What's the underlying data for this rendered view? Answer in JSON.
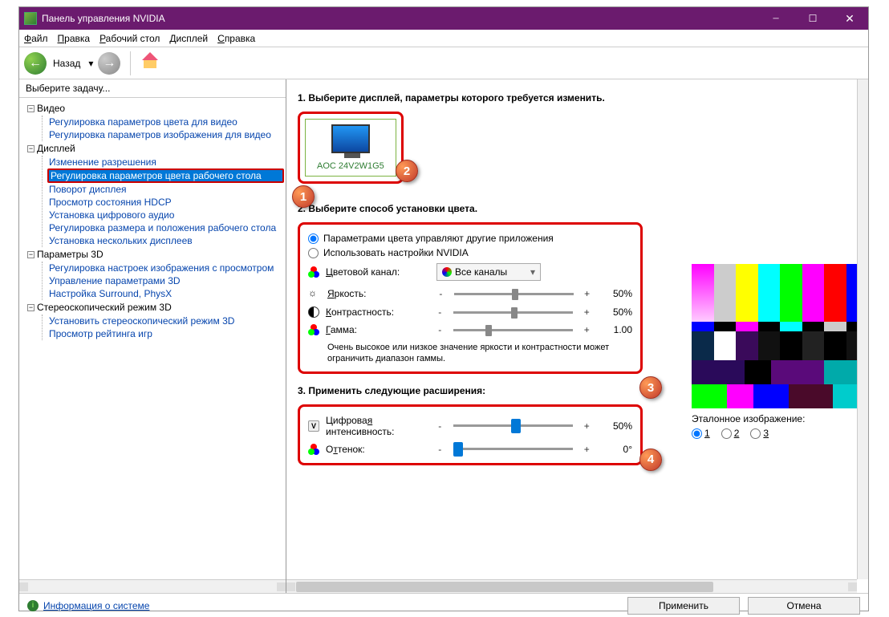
{
  "window": {
    "title": "Панель управления NVIDIA"
  },
  "menu": {
    "file": "Файл",
    "edit": "Правка",
    "desktop": "Рабочий стол",
    "display": "Дисплей",
    "help": "Справка"
  },
  "toolbar": {
    "back": "Назад"
  },
  "sidebar": {
    "header": "Выберите задачу...",
    "groups": [
      {
        "label": "Видео",
        "items": [
          "Регулировка параметров цвета для видео",
          "Регулировка параметров изображения для видео"
        ]
      },
      {
        "label": "Дисплей",
        "items": [
          "Изменение разрешения",
          "Регулировка параметров цвета рабочего стола",
          "Поворот дисплея",
          "Просмотр состояния HDCP",
          "Установка цифрового аудио",
          "Регулировка размера и положения рабочего стола",
          "Установка нескольких дисплеев"
        ],
        "selected": 1
      },
      {
        "label": "Параметры 3D",
        "items": [
          "Регулировка настроек изображения с просмотром",
          "Управление параметрами 3D",
          "Настройка Surround, PhysX"
        ]
      },
      {
        "label": "Стереоскопический режим 3D",
        "items": [
          "Установить стереоскопический режим 3D",
          "Просмотр рейтинга игр"
        ]
      }
    ]
  },
  "main": {
    "section1_title": "1. Выберите дисплей, параметры которого требуется изменить.",
    "display_name": "AOC 24V2W1G5",
    "section2_title": "2. Выберите способ установки цвета.",
    "radio1": "Параметрами цвета управляют другие приложения",
    "radio2": "Использовать настройки NVIDIA",
    "channel_label": "Цветовой канал:",
    "channel_value": "Все каналы",
    "brightness_label": "Яркость:",
    "brightness_value": "50%",
    "contrast_label": "Контрастность:",
    "contrast_value": "50%",
    "gamma_label": "Гамма:",
    "gamma_value": "1.00",
    "note": "Очень высокое или низкое значение яркости и контрастности может ограничить диапазон гаммы.",
    "section3_title": "3. Применить следующие расширения:",
    "vibrance_label": "Цифровая интенсивность:",
    "vibrance_value": "50%",
    "hue_label": "Оттенок:",
    "hue_value": "0°",
    "ref_label": "Эталонное изображение:",
    "ref1": "1",
    "ref2": "2",
    "ref3": "3"
  },
  "footer": {
    "sysinfo": "Информация о системе",
    "apply": "Применить",
    "cancel": "Отмена"
  },
  "callouts": {
    "c1": "1",
    "c2": "2",
    "c3": "3",
    "c4": "4"
  }
}
